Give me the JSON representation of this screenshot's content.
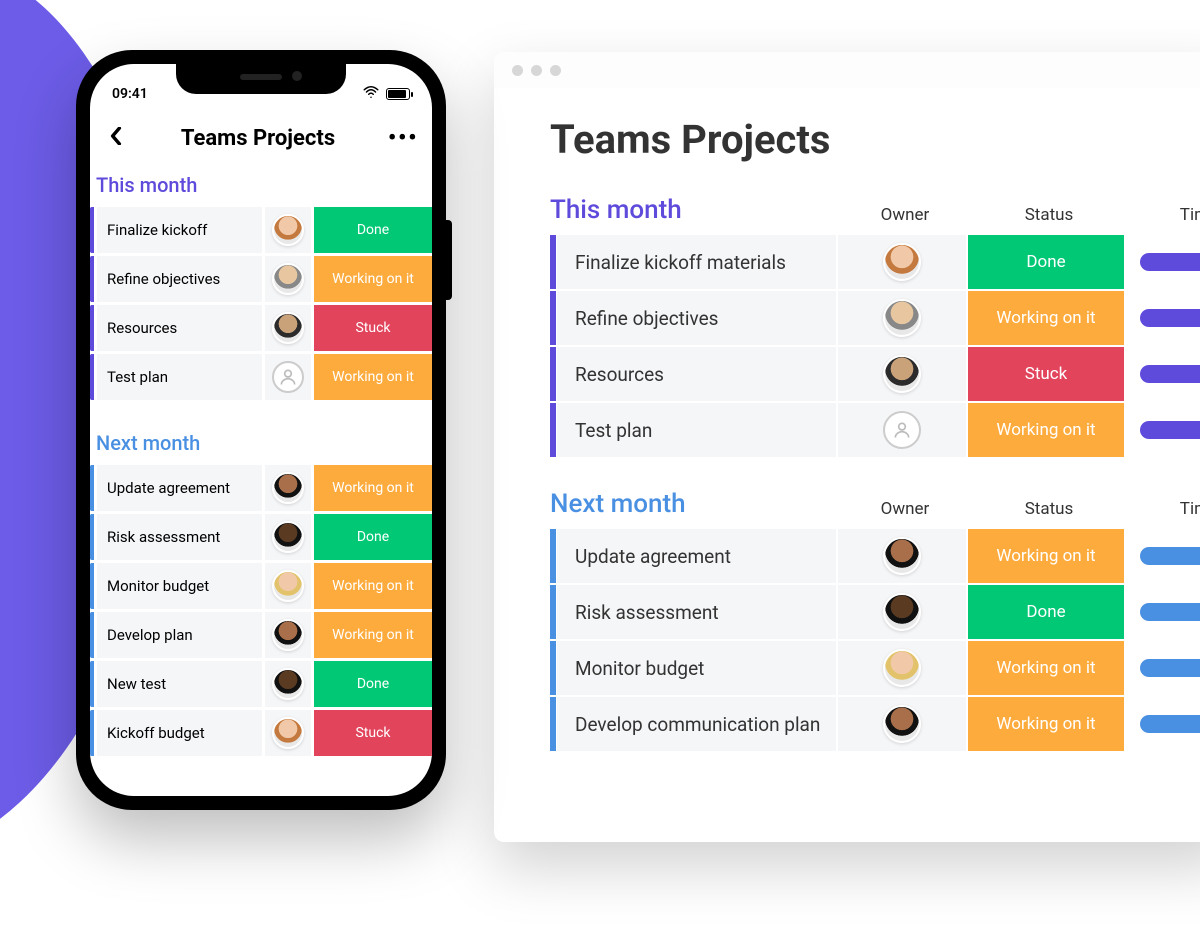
{
  "statusBar": {
    "time": "09:41"
  },
  "mobile": {
    "title": "Teams Projects",
    "sections": [
      {
        "title": "This month",
        "color": "purple",
        "rows": [
          {
            "name": "Finalize kickoff",
            "status": "Done",
            "statusClass": "st-done",
            "avatar": "av-1"
          },
          {
            "name": "Refine objectives",
            "status": "Working on it",
            "statusClass": "st-working",
            "avatar": "av-2"
          },
          {
            "name": "Resources",
            "status": "Stuck",
            "statusClass": "st-stuck",
            "avatar": "av-3"
          },
          {
            "name": "Test plan",
            "status": "Working on it",
            "statusClass": "st-working",
            "avatar": "empty"
          }
        ]
      },
      {
        "title": "Next month",
        "color": "blue",
        "rows": [
          {
            "name": "Update agreement",
            "status": "Working on it",
            "statusClass": "st-working",
            "avatar": "av-4"
          },
          {
            "name": "Risk assessment",
            "status": "Done",
            "statusClass": "st-done",
            "avatar": "av-5"
          },
          {
            "name": "Monitor budget",
            "status": "Working on it",
            "statusClass": "st-working",
            "avatar": "av-6"
          },
          {
            "name": "Develop plan",
            "status": "Working on it",
            "statusClass": "st-working",
            "avatar": "av-4"
          },
          {
            "name": "New test",
            "status": "Done",
            "statusClass": "st-done",
            "avatar": "av-5"
          },
          {
            "name": "Kickoff budget",
            "status": "Stuck",
            "statusClass": "st-stuck",
            "avatar": "av-1"
          }
        ]
      }
    ]
  },
  "desktop": {
    "title": "Teams Projects",
    "columns": {
      "owner": "Owner",
      "status": "Status",
      "time": "Time"
    },
    "sections": [
      {
        "title": "This month",
        "color": "purple",
        "pill": "pill-purple",
        "rows": [
          {
            "name": "Finalize kickoff materials",
            "status": "Done",
            "statusClass": "st-done",
            "avatar": "av-1"
          },
          {
            "name": "Refine objectives",
            "status": "Working on it",
            "statusClass": "st-working",
            "avatar": "av-2"
          },
          {
            "name": "Resources",
            "status": "Stuck",
            "statusClass": "st-stuck",
            "avatar": "av-3"
          },
          {
            "name": "Test plan",
            "status": "Working on it",
            "statusClass": "st-working",
            "avatar": "empty"
          }
        ]
      },
      {
        "title": "Next month",
        "color": "blue",
        "pill": "pill-blue",
        "rows": [
          {
            "name": "Update agreement",
            "status": "Working on it",
            "statusClass": "st-working",
            "avatar": "av-4"
          },
          {
            "name": "Risk assessment",
            "status": "Done",
            "statusClass": "st-done",
            "avatar": "av-5"
          },
          {
            "name": "Monitor budget",
            "status": "Working on it",
            "statusClass": "st-working",
            "avatar": "av-6"
          },
          {
            "name": "Develop communication plan",
            "status": "Working on it",
            "statusClass": "st-working",
            "avatar": "av-4"
          }
        ]
      }
    ]
  }
}
